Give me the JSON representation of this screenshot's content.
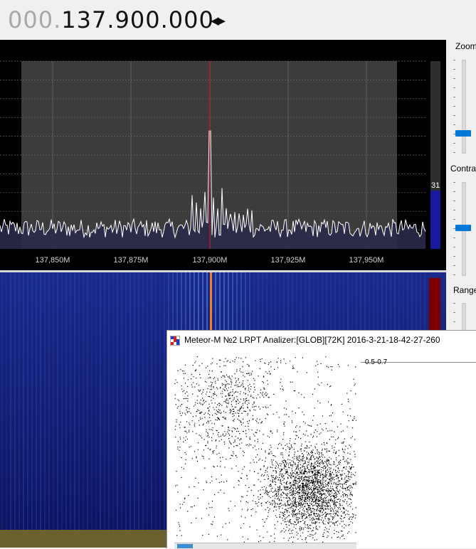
{
  "frequency": {
    "dim_digits": "000.",
    "main_digits": "137.900.000",
    "arrows": "◀▶"
  },
  "spectrum": {
    "axis_labels": [
      "137,850M",
      "137,875M",
      "137,900M",
      "137,925M",
      "137,950M"
    ],
    "level_value": "31"
  },
  "right_panel": {
    "zoom_label": "Zoom",
    "contrast_label": "Contrast",
    "range_label": "Range"
  },
  "analyzer": {
    "title": "Meteor-M №2 LRPT Analizer:[GLOB][72K] 2016-3-21-18-42-27-260",
    "scale_label": "0.5-0.7"
  },
  "colors": {
    "spectrum_bg": "#000000",
    "plot_bg": "#3c3c3c",
    "trace": "#ffffff",
    "center_marker": "#d42020",
    "waterfall_bg": "#0a0a3a",
    "level_bar": "#1a1aa0",
    "slider_thumb": "#0078d7"
  },
  "icons": [
    "arrow-left-icon",
    "arrow-right-icon",
    "app-icon"
  ]
}
